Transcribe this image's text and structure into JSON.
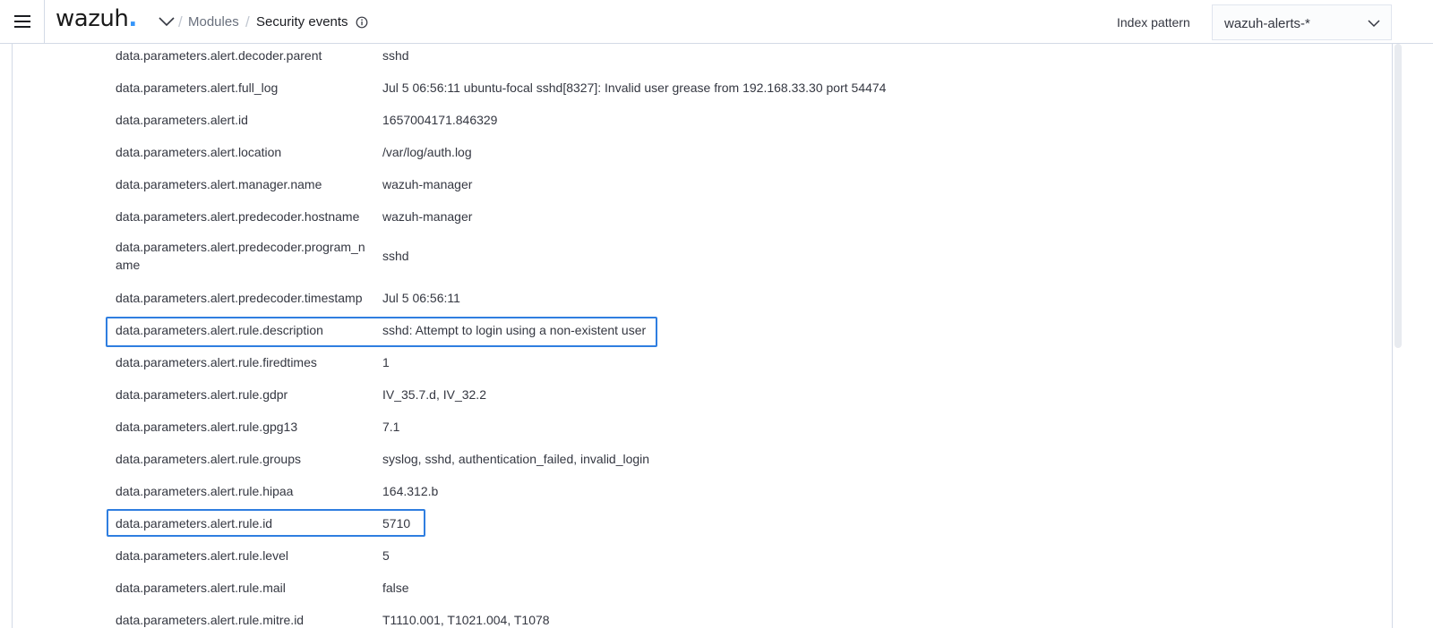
{
  "header": {
    "logo_text": "wazuh",
    "logo_dot": ".",
    "breadcrumb_modules": "Modules",
    "breadcrumb_current": "Security events",
    "separator": "/",
    "index_pattern_label": "Index pattern",
    "index_pattern_value": "wazuh-alerts-*"
  },
  "colors": {
    "accent": "#3595f9",
    "highlight": "#2f7ee0"
  },
  "fields": [
    {
      "key": "data.parameters.alert.decoder.parent",
      "value": "sshd"
    },
    {
      "key": "data.parameters.alert.full_log",
      "value": "Jul 5 06:56:11 ubuntu-focal sshd[8327]: Invalid user grease from 192.168.33.30 port 54474"
    },
    {
      "key": "data.parameters.alert.id",
      "value": "1657004171.846329"
    },
    {
      "key": "data.parameters.alert.location",
      "value": "/var/log/auth.log"
    },
    {
      "key": "data.parameters.alert.manager.name",
      "value": "wazuh-manager"
    },
    {
      "key": "data.parameters.alert.predecoder.hostname",
      "value": "wazuh-manager"
    },
    {
      "key": "data.parameters.alert.predecoder.program_name",
      "value": "sshd"
    },
    {
      "key": "data.parameters.alert.predecoder.timestamp",
      "value": "Jul 5 06:56:11"
    },
    {
      "key": "data.parameters.alert.rule.description",
      "value": "sshd: Attempt to login using a non-existent user"
    },
    {
      "key": "data.parameters.alert.rule.firedtimes",
      "value": "1"
    },
    {
      "key": "data.parameters.alert.rule.gdpr",
      "value": "IV_35.7.d, IV_32.2"
    },
    {
      "key": "data.parameters.alert.rule.gpg13",
      "value": "7.1"
    },
    {
      "key": "data.parameters.alert.rule.groups",
      "value": "syslog, sshd, authentication_failed, invalid_login"
    },
    {
      "key": "data.parameters.alert.rule.hipaa",
      "value": "164.312.b"
    },
    {
      "key": "data.parameters.alert.rule.id",
      "value": "5710"
    },
    {
      "key": "data.parameters.alert.rule.level",
      "value": "5"
    },
    {
      "key": "data.parameters.alert.rule.mail",
      "value": "false"
    },
    {
      "key": "data.parameters.alert.rule.mitre.id",
      "value": "T1110.001, T1021.004, T1078"
    }
  ]
}
